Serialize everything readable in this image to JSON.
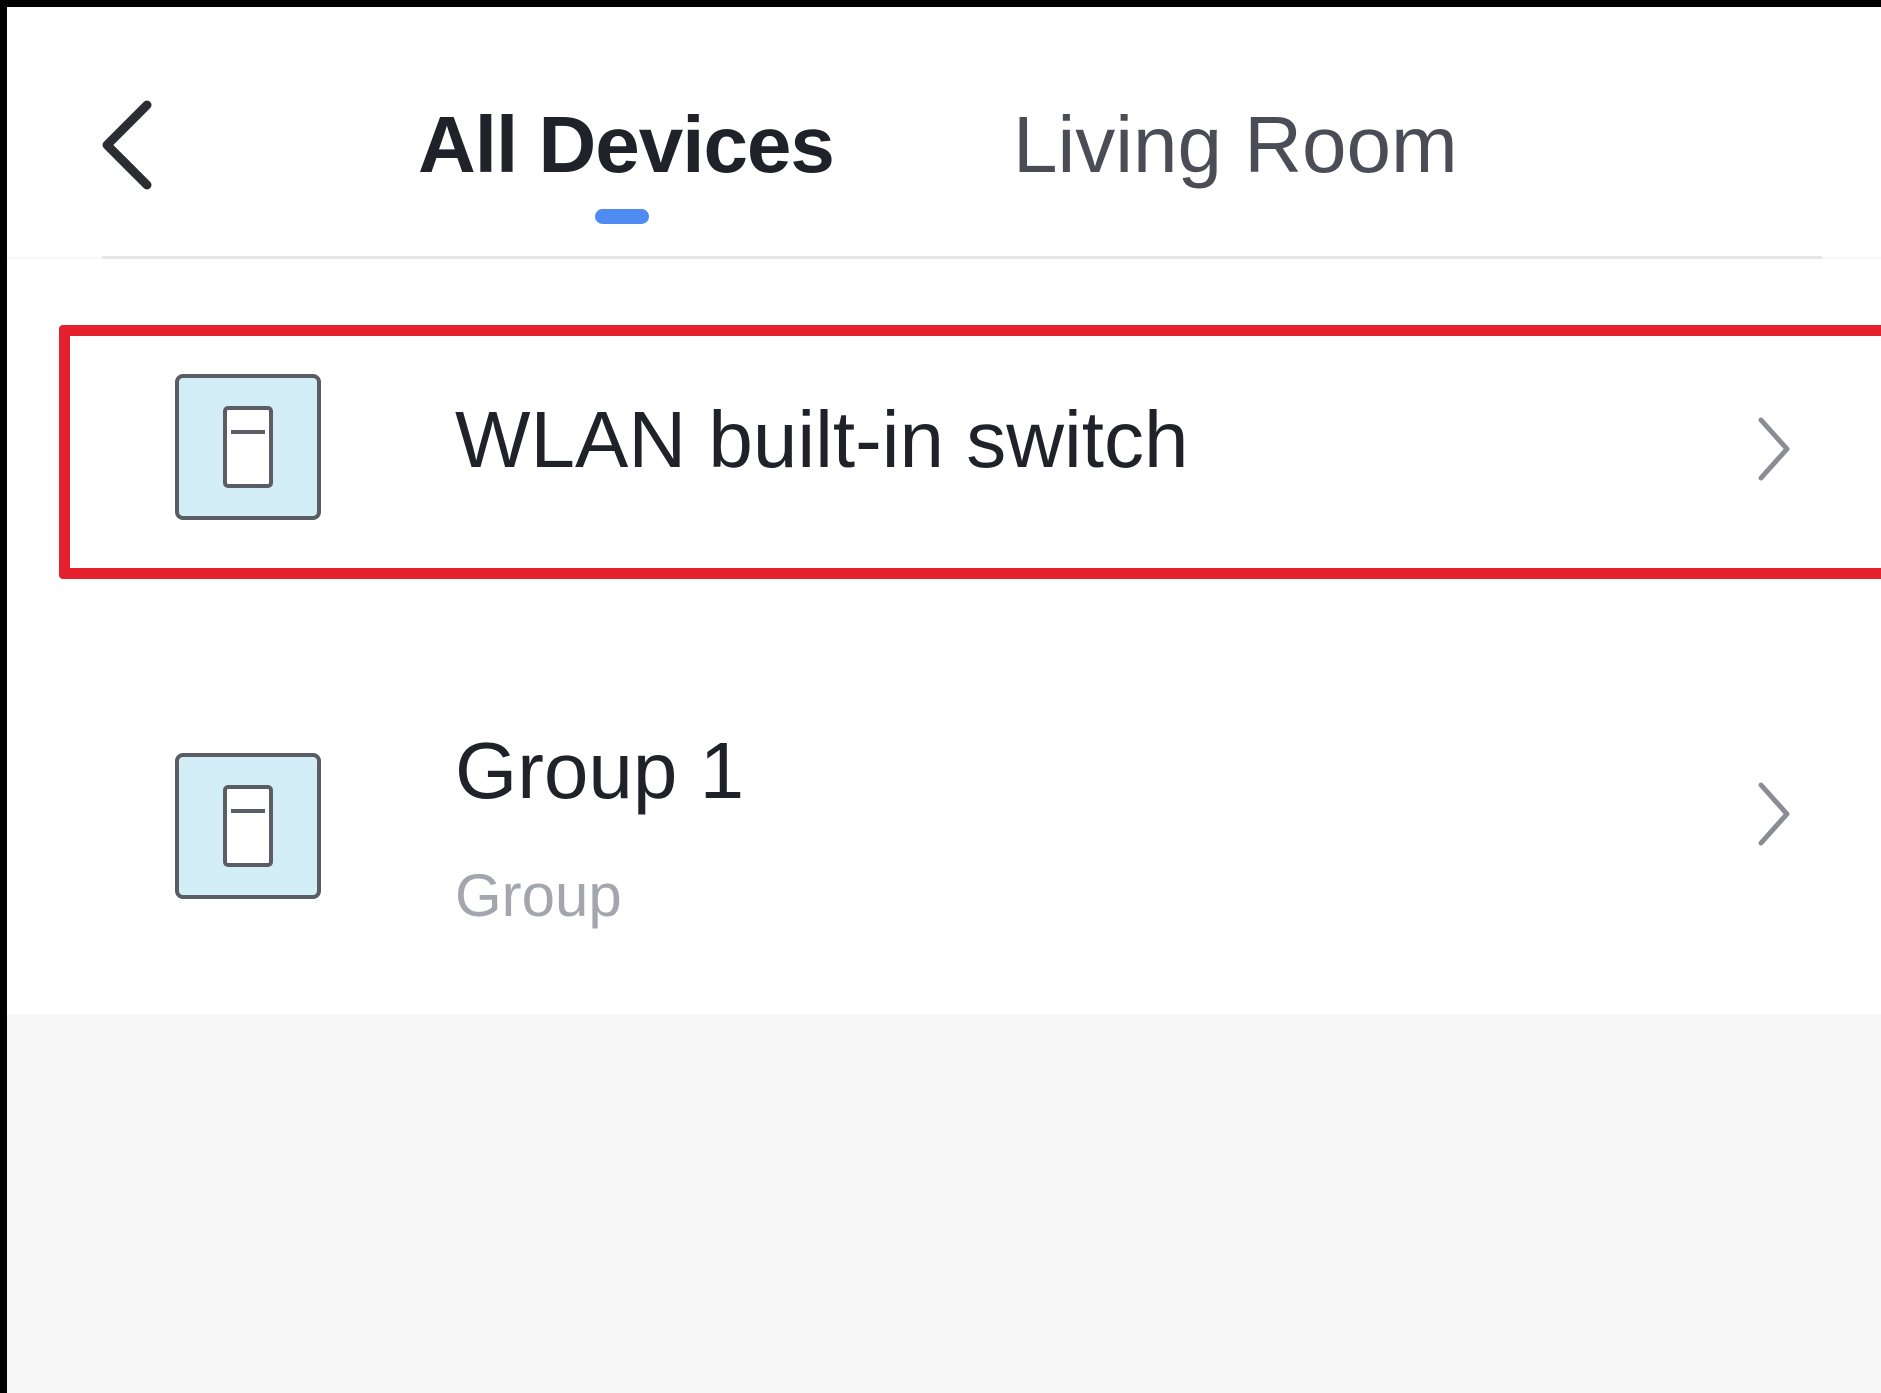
{
  "header": {
    "back_icon": "chevron-left-icon",
    "tabs": [
      {
        "label": "All Devices",
        "active": true
      },
      {
        "label": "Living Room",
        "active": false
      }
    ],
    "accent_color": "#4f8bf0"
  },
  "devices": [
    {
      "name": "WLAN built-in switch",
      "subtitle": "",
      "icon": "wall-switch-icon",
      "highlighted": true
    },
    {
      "name": "Group 1",
      "subtitle": "Group",
      "icon": "wall-switch-icon",
      "highlighted": false
    }
  ],
  "colors": {
    "highlight": "#e3202b",
    "icon_fill": "#d4eef8",
    "text_primary": "#1f2329",
    "text_secondary": "#a3a6ad",
    "background": "#f7f7f7"
  }
}
